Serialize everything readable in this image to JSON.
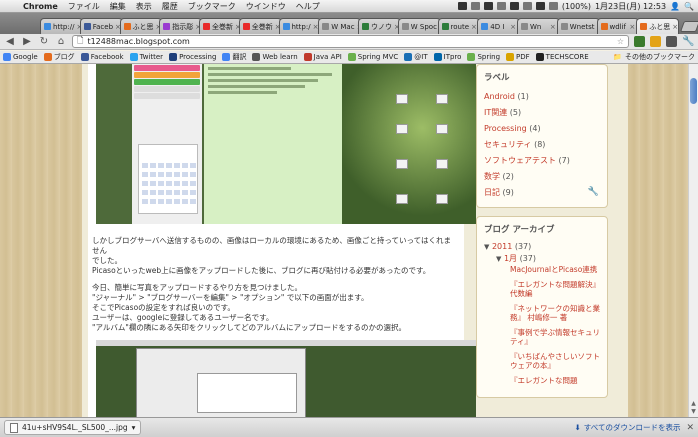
{
  "menubar": {
    "app": "Chrome",
    "items": [
      "ファイル",
      "編集",
      "表示",
      "履歴",
      "ブックマーク",
      "ウインドウ",
      "ヘルプ"
    ],
    "battery": "(100%)",
    "datetime": "1月23日(月)  12:53"
  },
  "tabs": [
    {
      "label": "http://",
      "color": "#3b8be0"
    },
    {
      "label": "Faceb",
      "color": "#3b5998"
    },
    {
      "label": "ふと思",
      "color": "#e46b1c"
    },
    {
      "label": "指示彫",
      "color": "#9a3ad0"
    },
    {
      "label": "全巻新",
      "color": "#e82a2a"
    },
    {
      "label": "全巻新",
      "color": "#e82a2a"
    },
    {
      "label": "http:/",
      "color": "#3b8be0"
    },
    {
      "label": "W Mac",
      "color": "#888888"
    },
    {
      "label": "ウノウ",
      "color": "#2c7c3a"
    },
    {
      "label": "W Spoc",
      "color": "#888888"
    },
    {
      "label": "route",
      "color": "#2c7c3a"
    },
    {
      "label": "4D I",
      "color": "#3b8be0"
    },
    {
      "label": "Wn",
      "color": "#888888"
    },
    {
      "label": "Wnetst",
      "color": "#888888"
    },
    {
      "label": "wdlif",
      "color": "#e46b1c"
    },
    {
      "label": "ふと思",
      "color": "#e46b1c"
    }
  ],
  "toolbar": {
    "url": "t12488mac.blogspot.com"
  },
  "bookmarks": [
    {
      "label": "Google",
      "color": "#4285f4"
    },
    {
      "label": "ブログ",
      "color": "#e46b1c"
    },
    {
      "label": "Facebook",
      "color": "#3b5998"
    },
    {
      "label": "Twitter",
      "color": "#2aa3ef"
    },
    {
      "label": "Processing",
      "color": "#1f3f7a"
    },
    {
      "label": "翻訳",
      "color": "#4285f4"
    },
    {
      "label": "Web learn",
      "color": "#555555"
    },
    {
      "label": "Java API",
      "color": "#c0392b"
    },
    {
      "label": "Spring MVC",
      "color": "#6ab04c"
    },
    {
      "label": "@IT",
      "color": "#1a6fb5"
    },
    {
      "label": "ITpro",
      "color": "#0066aa"
    },
    {
      "label": "Spring",
      "color": "#6ab04c"
    },
    {
      "label": "PDF",
      "color": "#d9a400"
    },
    {
      "label": "TECHSCORE",
      "color": "#222222"
    }
  ],
  "other_bookmarks": "その他のブックマーク",
  "post": {
    "paragraphs": [
      "しかしブログサーバへ送信するものの、画像はローカルの環境にあるため、画像ごと持っていってはくれません",
      "でした。",
      "Picasoといったweb上に画像をアップロードした後に、ブログに再び貼付ける必要があったのです。",
      "",
      "今日、簡単に写真をアップロードするやり方を見つけました。",
      "\"ジャーナル\" > \"ブログサーバーを編集\" > \"オプション\" で以下の画面が出ます。",
      "そこでPicasoの設定をすれば良いのです。",
      "ユーザーは、googleに登録してあるユーザー名です。",
      "\"アルバム\"欄の隣にある矢印をクリックしてどのアルバムにアップロードをするのかの選択。"
    ]
  },
  "labels_widget": {
    "title": "ラベル",
    "items": [
      {
        "name": "Android",
        "count": "(1)"
      },
      {
        "name": "IT関連",
        "count": "(5)"
      },
      {
        "name": "Processing",
        "count": "(4)"
      },
      {
        "name": "セキュリティ",
        "count": "(8)"
      },
      {
        "name": "ソフトウェアテスト",
        "count": "(7)"
      },
      {
        "name": "数学",
        "count": "(2)"
      },
      {
        "name": "日記",
        "count": "(9)"
      }
    ]
  },
  "archive_widget": {
    "title": "ブログ アーカイブ",
    "year": "2011",
    "year_count": "(37)",
    "month": "1月",
    "month_count": "(37)",
    "posts": [
      "MacJournalとPicaso連携",
      "『エレガントな問題解決』代数編",
      "『ネットワークの知識と業務』 村嶋修一 著",
      "『事例で学ぶ情報セキュリティ』",
      "『いちばんやさしいソフトウェアの本』",
      "『エレガントな問題"
    ]
  },
  "shelf": {
    "filename": "41u+sHV9S4L._SL500_...jpg",
    "show_all": "すべてのダウンロードを表示"
  }
}
